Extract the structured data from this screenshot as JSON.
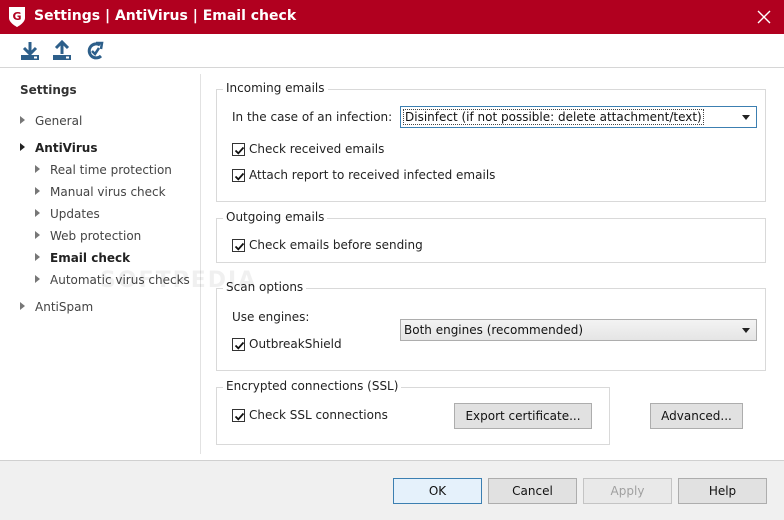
{
  "window": {
    "title": "Settings | AntiVirus | Email check",
    "brand_color": "#b1001f",
    "logo_icon": "gdata-shield-icon",
    "close_icon": "close-icon"
  },
  "toolbar": {
    "buttons": [
      {
        "icon": "import-icon"
      },
      {
        "icon": "export-icon"
      },
      {
        "icon": "restore-defaults-icon"
      }
    ]
  },
  "sidebar": {
    "heading": "Settings",
    "items": [
      {
        "label": "General",
        "expanded": false
      },
      {
        "label": "AntiVirus",
        "expanded": true
      },
      {
        "label": "Real time protection"
      },
      {
        "label": "Manual virus check"
      },
      {
        "label": "Updates"
      },
      {
        "label": "Web protection"
      },
      {
        "label": "Email check",
        "selected": true
      },
      {
        "label": "Automatic virus checks"
      },
      {
        "label": "AntiSpam",
        "expanded": false
      }
    ]
  },
  "incoming": {
    "title": "Incoming emails",
    "infection_label": "In the case of an infection:",
    "infection_value": "Disinfect (if not possible: delete attachment/text)",
    "check_received": {
      "label": "Check received emails",
      "checked": true
    },
    "attach_report": {
      "label": "Attach report to received infected emails",
      "checked": true
    }
  },
  "outgoing": {
    "title": "Outgoing emails",
    "check_before_sending": {
      "label": "Check emails before sending",
      "checked": true
    }
  },
  "scan": {
    "title": "Scan options",
    "engines_label": "Use engines:",
    "engines_value": "Both engines (recommended)",
    "outbreakshield": {
      "label": "OutbreakShield",
      "checked": true
    }
  },
  "ssl": {
    "title": "Encrypted connections (SSL)",
    "check_ssl": {
      "label": "Check SSL connections",
      "checked": true
    },
    "export_label": "Export certificate..."
  },
  "advanced_label": "Advanced...",
  "footer": {
    "ok": "OK",
    "cancel": "Cancel",
    "apply": "Apply",
    "help": "Help"
  }
}
